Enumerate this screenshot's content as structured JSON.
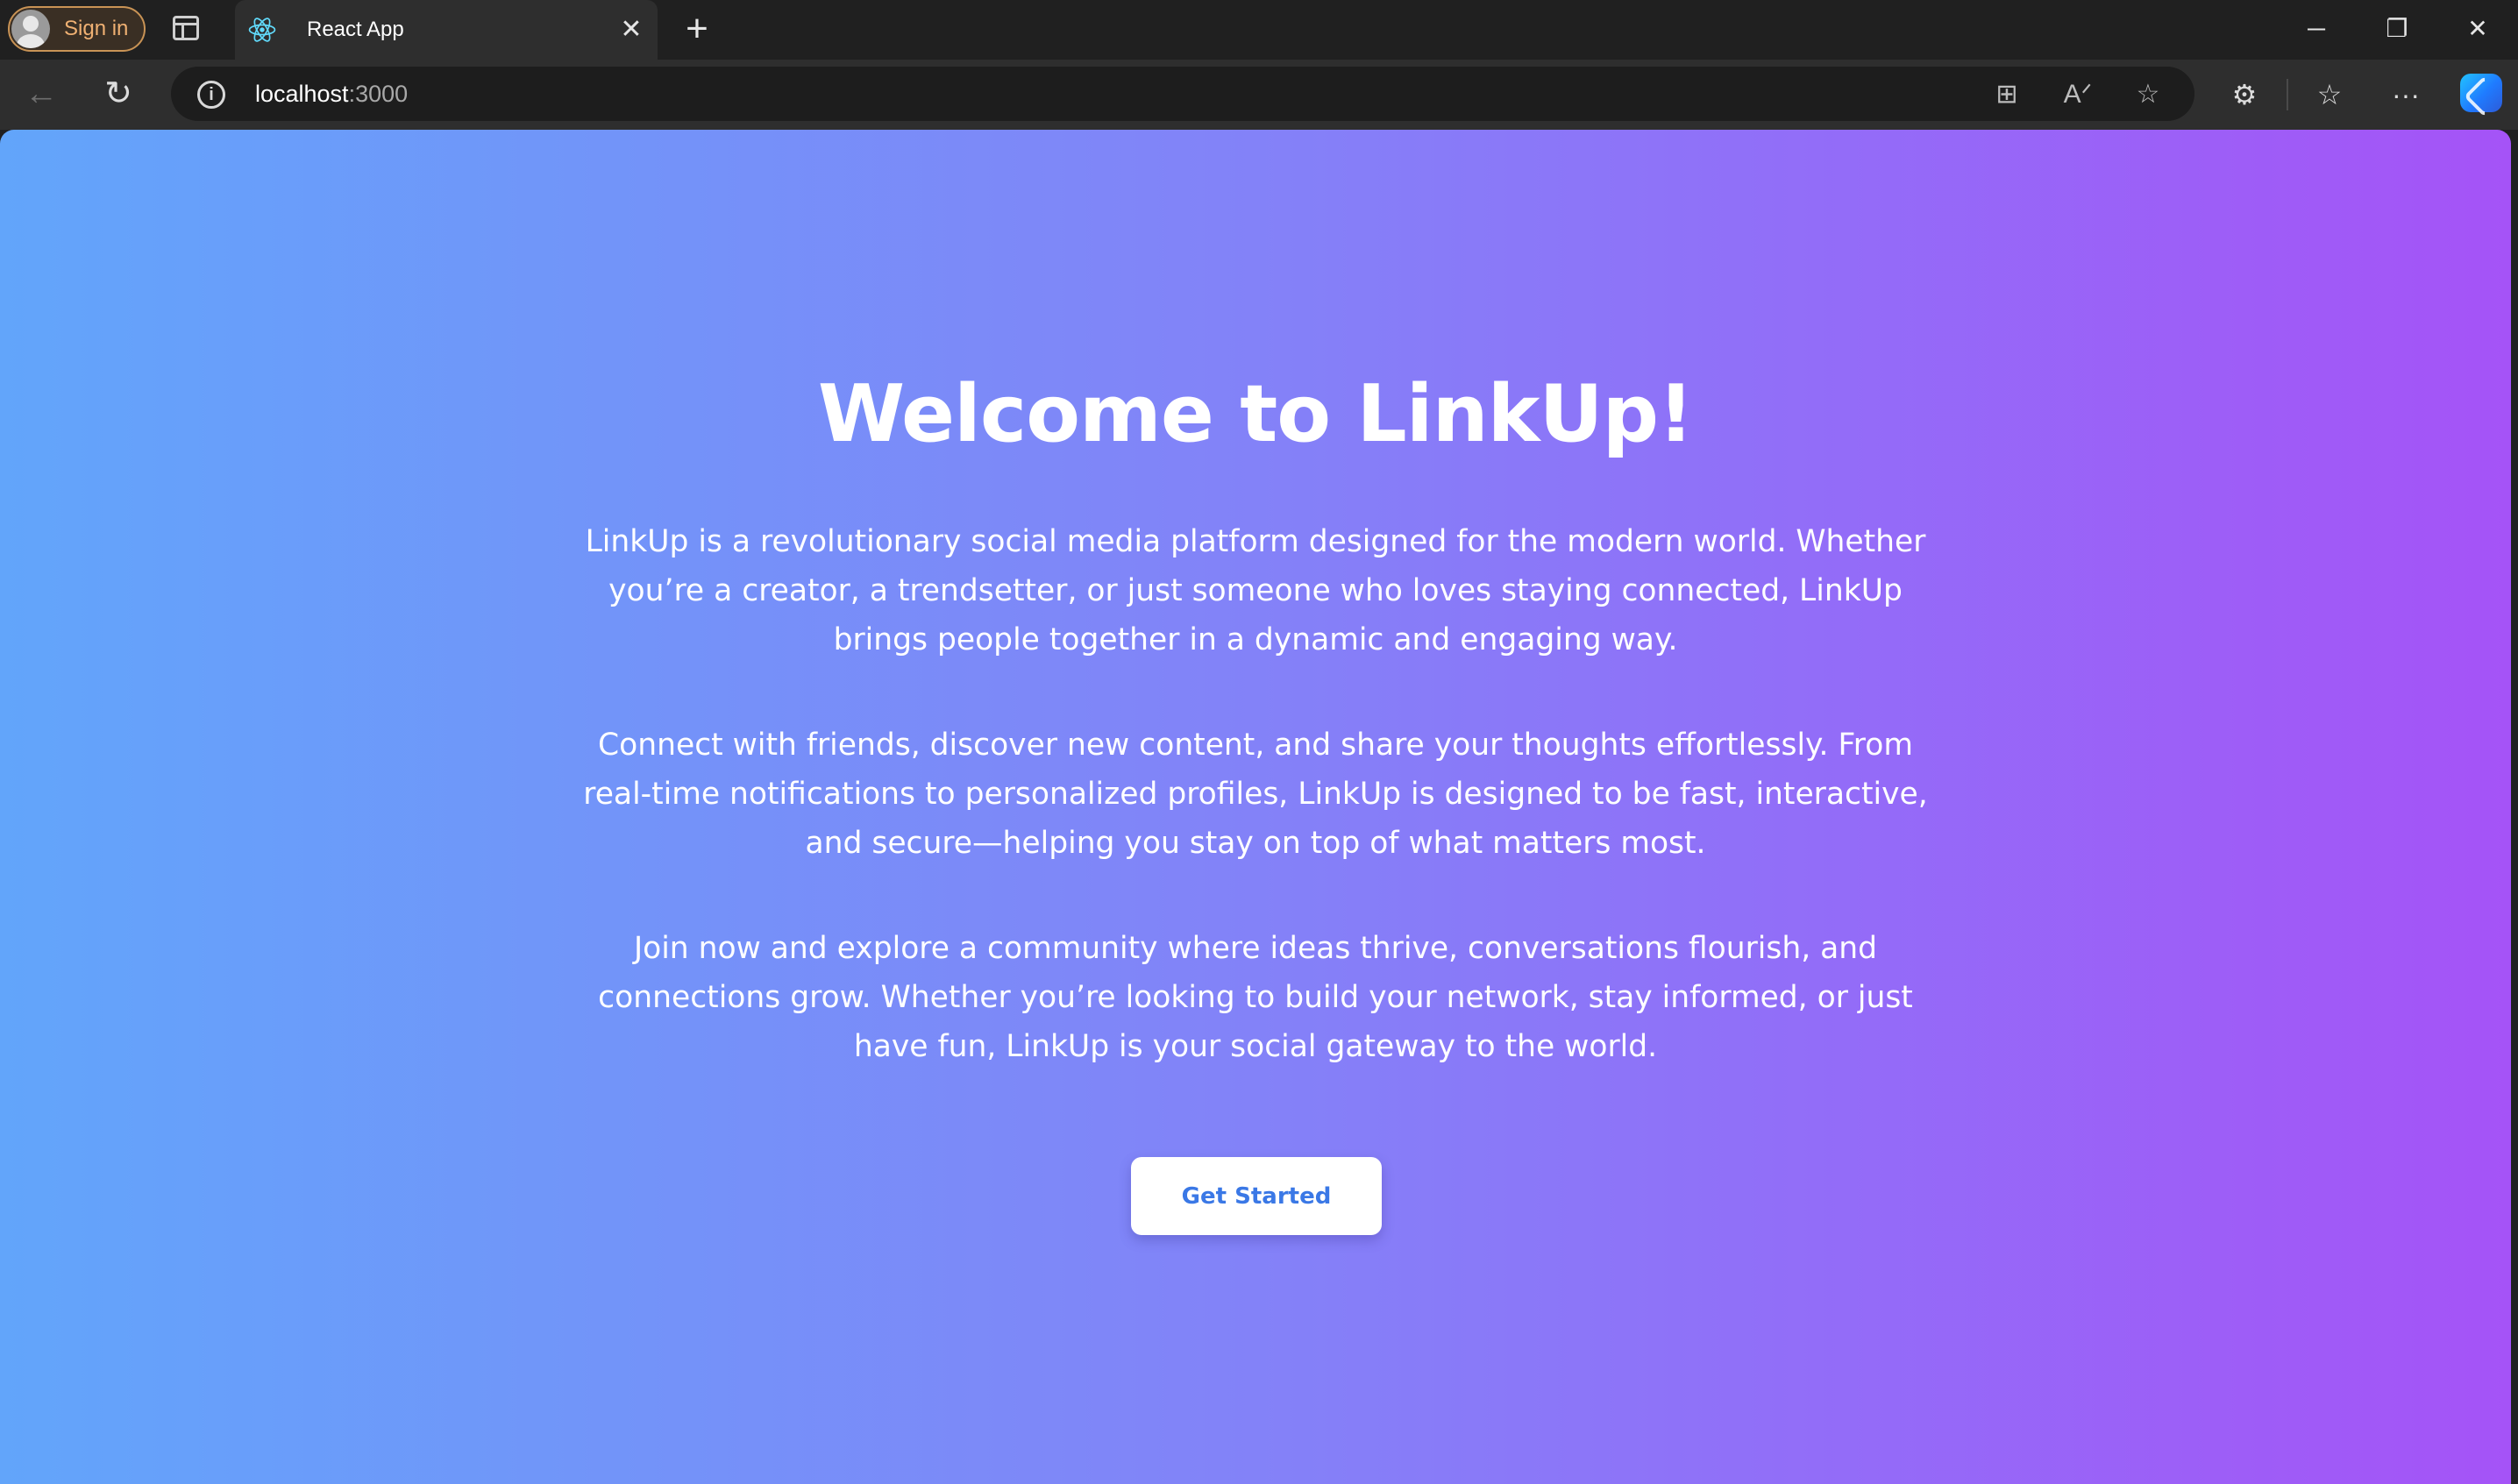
{
  "browser": {
    "signin_label": "Sign in",
    "tab_title": "React App",
    "url_host": "localhost",
    "url_port": ":3000",
    "icons": {
      "tab_actions": "tab-actions-icon",
      "favicon": "react-icon",
      "close": "close-icon",
      "new_tab": "plus-icon",
      "back": "back-arrow-icon",
      "reload": "reload-icon",
      "info": "info-icon",
      "app_available": "app-available-icon",
      "read_aloud": "read-aloud-icon",
      "favorite": "star-icon",
      "extensions": "puzzle-icon",
      "favorites": "favorites-icon",
      "more": "more-icon",
      "copilot": "copilot-icon",
      "minimize": "minimize-icon",
      "restore": "restore-icon",
      "window_close": "window-close-icon"
    }
  },
  "page": {
    "heading": "Welcome to LinkUp!",
    "paragraphs": [
      "LinkUp is a revolutionary social media platform designed for the modern world. Whether you’re a creator, a trendsetter, or just someone who loves staying connected, LinkUp brings people together in a dynamic and engaging way.",
      "Connect with friends, discover new content, and share your thoughts effortlessly. From real-time notifications to personalized profiles, LinkUp is designed to be fast, interactive, and secure—helping you stay on top of what matters most.",
      "Join now and explore a community where ideas thrive, conversations flourish, and connections grow. Whether you’re looking to build your network, stay informed, or just have fun, LinkUp is your social gateway to the world."
    ],
    "cta_label": "Get Started",
    "colors": {
      "gradient_start": "#62a5fa",
      "gradient_mid": "#8382f8",
      "gradient_end": "#a553f7",
      "cta_text": "#3a78e6"
    }
  }
}
